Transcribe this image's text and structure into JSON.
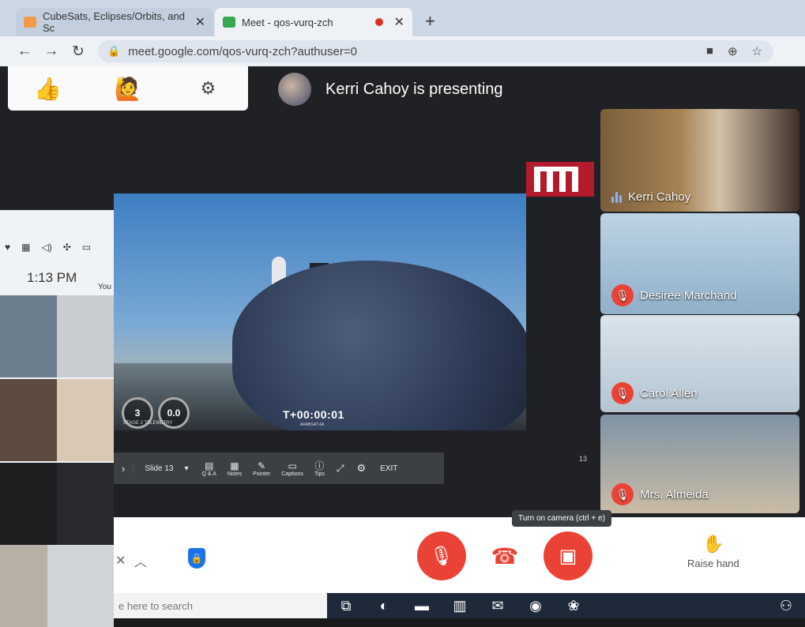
{
  "browser": {
    "tabs": [
      {
        "title": "CubeSats, Eclipses/Orbits, and Sc",
        "favicon_color": "#f2994a"
      },
      {
        "title": "Meet - qos-vurq-zch",
        "favicon_color": "#34a853"
      }
    ],
    "new_tab_label": "+",
    "url": "meet.google.com/qos-vurq-zch?authuser=0"
  },
  "meet": {
    "reactions": [
      "👍",
      "🙋"
    ],
    "presenting_text": "Kerri Cahoy is presenting",
    "participants": [
      {
        "name": "Kerri Cahoy",
        "state": "speaking"
      },
      {
        "name": "Desiree Marchand",
        "state": "muted"
      },
      {
        "name": "Carol Allen",
        "state": "muted"
      },
      {
        "name": "Mrs. Almeida",
        "state": "muted"
      }
    ],
    "controls": {
      "camera_tooltip": "Turn on camera (ctrl + e)",
      "raise_hand": "Raise hand"
    }
  },
  "slide": {
    "speed_value": "3",
    "altitude_value": "0.0",
    "telemetry_label": "STAGE 2 TELEMETRY",
    "countdown": "T+00:00:01",
    "countdown_sub": "ARABSAT-6A",
    "slide_number": "13",
    "toolbar": {
      "slide_label": "Slide 13",
      "items": [
        "Q & A",
        "Notes",
        "Pointer",
        "Captions",
        "Tips"
      ],
      "exit_label": "EXIT"
    }
  },
  "left_window": {
    "time": "1:13 PM",
    "you_label": "You"
  },
  "taskbar": {
    "search_placeholder": "e here to search"
  }
}
